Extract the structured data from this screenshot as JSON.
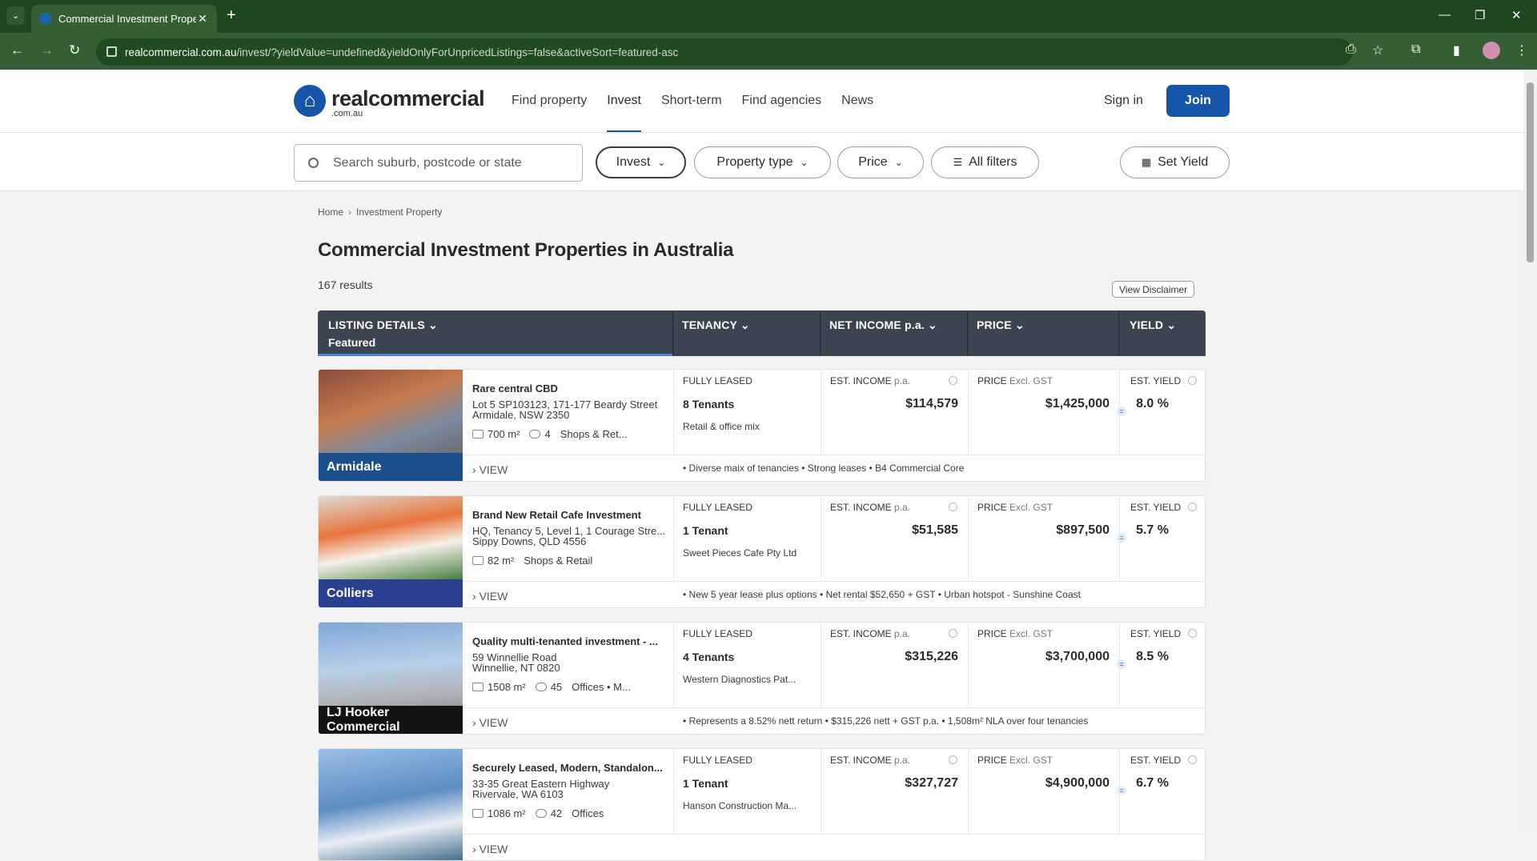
{
  "browser": {
    "tab_title": "Commercial Investment Prope",
    "url_host": "realcommercial.com.au",
    "url_path": "/invest/?yieldValue=undefined&yieldOnlyForUnpricedListings=false&activeSort=featured-asc"
  },
  "header": {
    "logo": "realcommercial",
    "logo_sub": ".com.au",
    "nav": [
      "Find property",
      "Invest",
      "Short-term",
      "Find agencies",
      "News"
    ],
    "sign_in": "Sign in",
    "join": "Join"
  },
  "filters": {
    "search_placeholder": "Search suburb, postcode or state",
    "invest": "Invest",
    "property_type": "Property type",
    "price": "Price",
    "all_filters": "All filters",
    "set_yield": "Set Yield"
  },
  "breadcrumb": {
    "home": "Home",
    "current": "Investment Property"
  },
  "page_title": "Commercial Investment Properties in Australia",
  "results": "167 results",
  "disclaimer": "View Disclaimer",
  "table_header": {
    "listing": "LISTING DETAILS",
    "listing_sub": "Featured",
    "tenancy": "TENANCY",
    "net_income": "NET INCOME p.a.",
    "price": "PRICE",
    "yield": "YIELD"
  },
  "labels": {
    "fully_leased": "FULLY LEASED",
    "est_income": "EST. INCOME",
    "pa": "p.a.",
    "price": "PRICE",
    "excl_gst": "Excl. GST",
    "est_yield": "EST. YIELD",
    "view": "VIEW"
  },
  "listings": [
    {
      "name": "Rare central CBD",
      "addr1": "Lot 5 SP103123, 171-177 Beardy Street",
      "addr2": "Armidale, NSW 2350",
      "area": "700 m²",
      "parking": "4",
      "ptype": "Shops & Ret...",
      "tenants": "8 Tenants",
      "tdesc": "Retail & office mix",
      "income": "$114,579",
      "price": "$1,425,000",
      "yield": "8.0 %",
      "brand": "Armidale",
      "highlights": "• Diverse maix of tenancies  • Strong leases  • B4 Commercial Core"
    },
    {
      "name": "Brand New Retail Cafe Investment",
      "addr1": "HQ, Tenancy 5, Level 1, 1 Courage Stre...",
      "addr2": "Sippy Downs, QLD 4556",
      "area": "82 m²",
      "parking": "",
      "ptype": "Shops & Retail",
      "tenants": "1 Tenant",
      "tdesc": "Sweet Pieces Cafe Pty Ltd",
      "income": "$51,585",
      "price": "$897,500",
      "yield": "5.7 %",
      "brand": "Colliers",
      "highlights": "• New 5 year lease plus options  • Net rental $52,650 + GST  • Urban hotspot - Sunshine Coast"
    },
    {
      "name": "Quality multi-tenanted investment - ...",
      "addr1": "59 Winnellie Road",
      "addr2": "Winnellie, NT 0820",
      "area": "1508 m²",
      "parking": "45",
      "ptype": "Offices • M...",
      "tenants": "4 Tenants",
      "tdesc": "Western Diagnostics Pat...",
      "income": "$315,226",
      "price": "$3,700,000",
      "yield": "8.5 %",
      "brand": "LJ Hooker Commercial",
      "highlights": "• Represents a 8.52% nett return  • $315,226 nett + GST p.a.  • 1,508m² NLA over four tenancies"
    },
    {
      "name": "Securely Leased, Modern, Standalon...",
      "addr1": "33-35 Great Eastern Highway",
      "addr2": "Rivervale, WA 6103",
      "area": "1086 m²",
      "parking": "42",
      "ptype": "Offices",
      "tenants": "1 Tenant",
      "tdesc": "Hanson Construction Ma...",
      "income": "$327,727",
      "price": "$4,900,000",
      "yield": "6.7 %",
      "brand": "",
      "highlights": ""
    }
  ],
  "colors": {
    "brand_blue": "#1655a9",
    "chrome_green": "#355e35",
    "table_head": "#3b4450"
  }
}
